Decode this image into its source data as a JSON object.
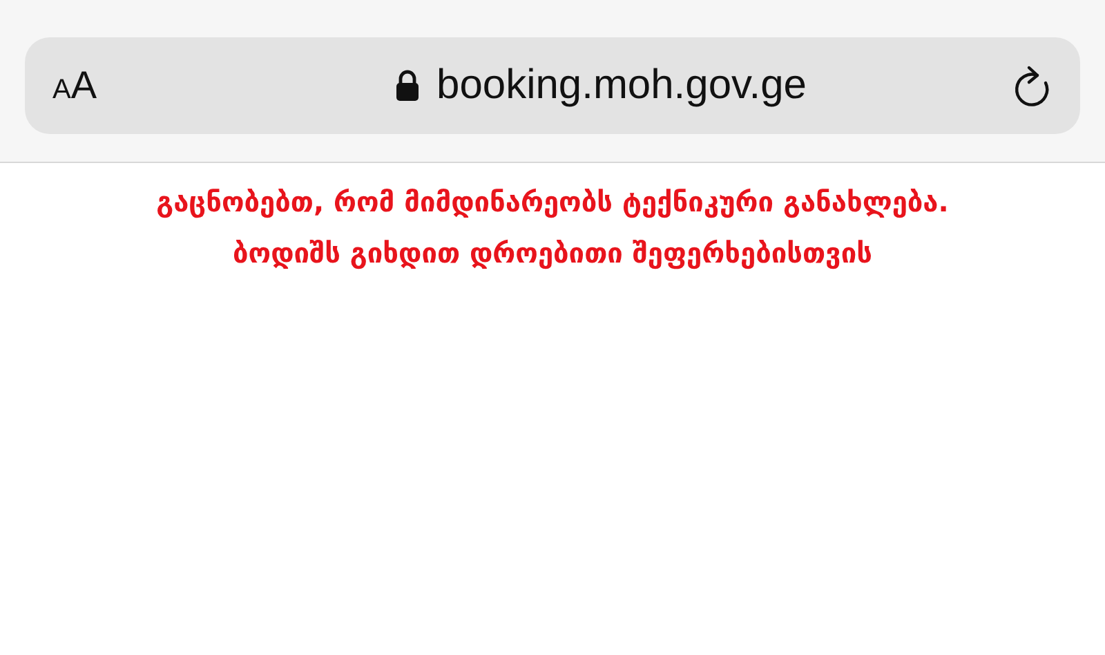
{
  "address_bar": {
    "text_size_button": {
      "small_letter": "A",
      "large_letter": "A"
    },
    "secure": true,
    "url": "booking.moh.gov.ge"
  },
  "notice": {
    "lines": [
      "გაცნობებთ, რომ მიმდინარეობს ტექნიკური განახლება.",
      "ბოდიშს გიხდით დროებითი შეფერხებისთვის"
    ]
  }
}
